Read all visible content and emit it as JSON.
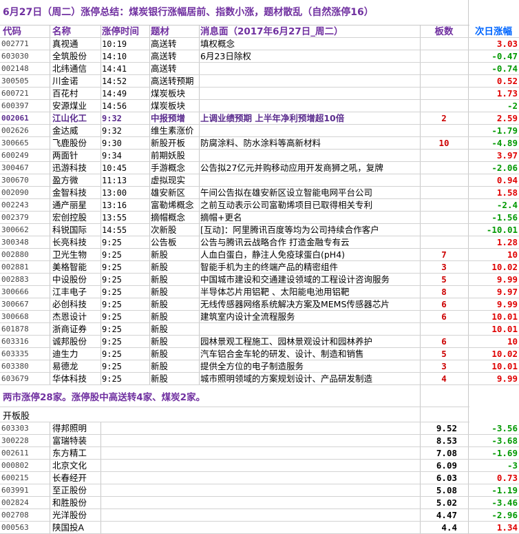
{
  "title": "6月27日（周二）涨停总结：煤炭银行涨幅居前、指数小涨，题材散乱（自然涨停16）",
  "headers": {
    "code": "代码",
    "name": "名称",
    "time": "涨停时间",
    "topic": "题材",
    "news": "消息面（2017年6月27日_周二）",
    "boards": "板数",
    "next": "次日涨幅"
  },
  "rows": [
    {
      "code": "002771",
      "name": "真视通",
      "time": "10:19",
      "topic": "高送转",
      "news": "填权概念",
      "boards": "",
      "next": "3.03",
      "dir": "up",
      "hl": false
    },
    {
      "code": "603030",
      "name": "全筑股份",
      "time": "14:10",
      "topic": "高送转",
      "news": "6月23日除权",
      "boards": "",
      "next": "-0.47",
      "dir": "down",
      "hl": false
    },
    {
      "code": "002148",
      "name": "北纬通信",
      "time": "14:41",
      "topic": "高送转",
      "news": "",
      "boards": "",
      "next": "-0.74",
      "dir": "down",
      "hl": false
    },
    {
      "code": "300505",
      "name": "川金诺",
      "time": "14:52",
      "topic": "高送转预期",
      "news": "",
      "boards": "",
      "next": "0.52",
      "dir": "up",
      "hl": false
    },
    {
      "code": "600721",
      "name": "百花村",
      "time": "14:49",
      "topic": "煤炭板块",
      "news": "",
      "boards": "",
      "next": "1.73",
      "dir": "up",
      "hl": false
    },
    {
      "code": "600397",
      "name": "安源煤业",
      "time": "14:56",
      "topic": "煤炭板块",
      "news": "",
      "boards": "",
      "next": "-2",
      "dir": "down",
      "hl": false
    },
    {
      "code": "002061",
      "name": "江山化工",
      "time": "9:32",
      "topic": "中报预增",
      "news": "上调业绩预期 上半年净利预增超10倍",
      "boards": "2",
      "next": "2.59",
      "dir": "up",
      "hl": true
    },
    {
      "code": "002626",
      "name": "金达威",
      "time": "9:32",
      "topic": "维生素涨价",
      "news": "",
      "boards": "",
      "next": "-1.79",
      "dir": "down",
      "hl": false
    },
    {
      "code": "300665",
      "name": "飞鹿股份",
      "time": "9:30",
      "topic": "新股开板",
      "news": "防腐涂料、防水涂料等高新材料",
      "boards": "10",
      "next": "-4.89",
      "dir": "down",
      "hl": false
    },
    {
      "code": "600249",
      "name": "两面针",
      "time": "9:34",
      "topic": "前期妖股",
      "news": "",
      "boards": "",
      "next": "3.97",
      "dir": "up",
      "hl": false
    },
    {
      "code": "300467",
      "name": "迅游科技",
      "time": "10:45",
      "topic": "手游概念",
      "news": "公告拟27亿元并购移动应用开发商狮之吼，复牌",
      "boards": "",
      "next": "-2.06",
      "dir": "down",
      "hl": false
    },
    {
      "code": "300670",
      "name": "盈方微",
      "time": "11:13",
      "topic": "虚拟现实",
      "news": "",
      "boards": "",
      "next": "0.94",
      "dir": "up",
      "hl": false
    },
    {
      "code": "002090",
      "name": "金智科技",
      "time": "13:00",
      "topic": "雄安新区",
      "news": "午间公告拟在雄安新区设立智能电网平台公司",
      "boards": "",
      "next": "1.58",
      "dir": "up",
      "hl": false
    },
    {
      "code": "002243",
      "name": "通产丽星",
      "time": "13:16",
      "topic": "富勒烯概念",
      "news": "之前互动表示公司富勒烯项目已取得相关专利",
      "boards": "",
      "next": "-2.4",
      "dir": "down",
      "hl": false
    },
    {
      "code": "002379",
      "name": "宏创控股",
      "time": "13:55",
      "topic": "摘帽概念",
      "news": "摘帽+更名",
      "boards": "",
      "next": "-1.56",
      "dir": "down",
      "hl": false
    },
    {
      "code": "300662",
      "name": "科锐国际",
      "time": "14:55",
      "topic": "次新股",
      "news": "[互动]：阿里腾讯百度等均为公司持续合作客户",
      "boards": "",
      "next": "-10.01",
      "dir": "down",
      "hl": false
    },
    {
      "code": "300348",
      "name": "长亮科技",
      "time": "9:25",
      "topic": "公告板",
      "news": "公告与腾讯云战略合作 打造金融专有云",
      "boards": "",
      "next": "1.28",
      "dir": "up",
      "hl": false
    },
    {
      "code": "002880",
      "name": "卫光生物",
      "time": "9:25",
      "topic": "新股",
      "news": "人血白蛋白，静注人免疫球蛋白(pH4)",
      "boards": "7",
      "next": "10",
      "dir": "up",
      "hl": false
    },
    {
      "code": "002881",
      "name": "美格智能",
      "time": "9:25",
      "topic": "新股",
      "news": "智能手机为主的终端产品的精密组件",
      "boards": "3",
      "next": "10.02",
      "dir": "up",
      "hl": false
    },
    {
      "code": "002883",
      "name": "中设股份",
      "time": "9:25",
      "topic": "新股",
      "news": "中国城市建设和交通建设领域的工程设计咨询服务",
      "boards": "5",
      "next": "9.99",
      "dir": "up",
      "hl": false
    },
    {
      "code": "300666",
      "name": "江丰电子",
      "time": "9:25",
      "topic": "新股",
      "news": "半导体芯片用铝靶 、太阳能电池用铝靶",
      "boards": "8",
      "next": "9.97",
      "dir": "up",
      "hl": false
    },
    {
      "code": "300667",
      "name": "必创科技",
      "time": "9:25",
      "topic": "新股",
      "news": "无线传感器网络系统解决方案及MEMS传感器芯片",
      "boards": "6",
      "next": "9.99",
      "dir": "up",
      "hl": false
    },
    {
      "code": "300668",
      "name": "杰恩设计",
      "time": "9:25",
      "topic": "新股",
      "news": "建筑室内设计全流程服务",
      "boards": "6",
      "next": "10.01",
      "dir": "up",
      "hl": false
    },
    {
      "code": "601878",
      "name": "浙商证券",
      "time": "9:25",
      "topic": "新股",
      "news": "",
      "boards": "",
      "next": "10.01",
      "dir": "up",
      "hl": false
    },
    {
      "code": "603316",
      "name": "诚邦股份",
      "time": "9:25",
      "topic": "新股",
      "news": "园林景观工程施工、园林景观设计和园林养护",
      "boards": "6",
      "next": "10",
      "dir": "up",
      "hl": false
    },
    {
      "code": "603335",
      "name": "迪生力",
      "time": "9:25",
      "topic": "新股",
      "news": "汽车铝合金车轮的研发、设计、制造和销售",
      "boards": "5",
      "next": "10.02",
      "dir": "up",
      "hl": false
    },
    {
      "code": "603380",
      "name": "易德龙",
      "time": "9:25",
      "topic": "新股",
      "news": "提供全方位的电子制造服务",
      "boards": "3",
      "next": "10.01",
      "dir": "up",
      "hl": false
    },
    {
      "code": "603679",
      "name": "华体科技",
      "time": "9:25",
      "topic": "新股",
      "news": "城市照明领域的方案规划设计、产品研发制造",
      "boards": "4",
      "next": "9.99",
      "dir": "up",
      "hl": false
    }
  ],
  "summary": "两市涨停28家。涨停股中高送转4家、煤炭2家。",
  "open_section": {
    "title": "开板股",
    "rows": [
      {
        "code": "603303",
        "name": "得邦照明",
        "pct": "9.52",
        "next": "-3.56",
        "dir": "down"
      },
      {
        "code": "300228",
        "name": "富瑞特装",
        "pct": "8.53",
        "next": "-3.68",
        "dir": "down"
      },
      {
        "code": "002611",
        "name": "东方精工",
        "pct": "7.08",
        "next": "-1.69",
        "dir": "down"
      },
      {
        "code": "000802",
        "name": "北京文化",
        "pct": "6.09",
        "next": "-3",
        "dir": "down"
      },
      {
        "code": "600215",
        "name": "长春经开",
        "pct": "6.03",
        "next": "0.73",
        "dir": "up"
      },
      {
        "code": "603991",
        "name": "至正股份",
        "pct": "5.08",
        "next": "-1.19",
        "dir": "down"
      },
      {
        "code": "002824",
        "name": "和胜股份",
        "pct": "5.02",
        "next": "-3.46",
        "dir": "down"
      },
      {
        "code": "002708",
        "name": "光洋股份",
        "pct": "4.47",
        "next": "-2.96",
        "dir": "down"
      },
      {
        "code": "000563",
        "name": "陕国投A",
        "pct": "4.4",
        "next": "1.34",
        "dir": "up"
      }
    ]
  },
  "colors": {
    "up": "#e00000",
    "down": "#009900",
    "accent": "#7030a0",
    "next_header": "#0066ff"
  }
}
